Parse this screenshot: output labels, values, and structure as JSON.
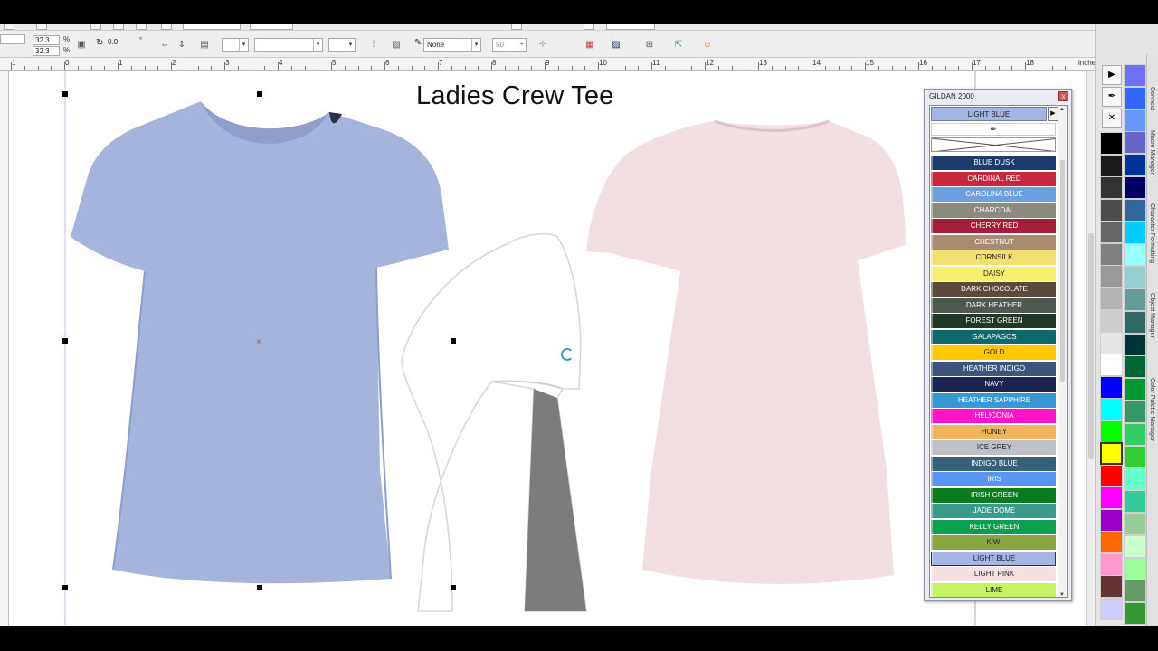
{
  "toolbar": {
    "size_w": "32.3",
    "size_h": "32.3",
    "pct_w": "%",
    "pct_h": "%",
    "rotation": "0.0",
    "degree": "°",
    "outline": "None",
    "opacity": "50"
  },
  "ruler": {
    "unit": "inches",
    "labels": [
      "1",
      "0",
      "1",
      "2",
      "3",
      "4",
      "5",
      "6",
      "7",
      "8",
      "9",
      "10",
      "11",
      "12",
      "13",
      "14",
      "15",
      "16",
      "17",
      "18"
    ]
  },
  "canvas": {
    "title": "Ladies Crew Tee"
  },
  "shirts": {
    "front_color": "#a4b4dc",
    "side_color": "#ffffff",
    "back_color": "#f1dfe2"
  },
  "docker": {
    "title": "GILDAN 2000",
    "close": "x",
    "current": "LIGHT BLUE",
    "current_arrow": "▶",
    "eyedropper": "✒",
    "scroll_up": "▲",
    "scroll_down": "▼",
    "colors": [
      {
        "name": "BLUE DUSK",
        "hex": "#1b3d6e"
      },
      {
        "name": "CARDINAL RED",
        "hex": "#c8283c"
      },
      {
        "name": "CAROLINA BLUE",
        "hex": "#6c9fdc"
      },
      {
        "name": "CHARCOAL",
        "hex": "#8a8a80"
      },
      {
        "name": "CHERRY RED",
        "hex": "#a51e3a"
      },
      {
        "name": "CHESTNUT",
        "hex": "#a88c72"
      },
      {
        "name": "CORNSILK",
        "hex": "#f4e070"
      },
      {
        "name": "DAISY",
        "hex": "#f6ef6b"
      },
      {
        "name": "DARK CHOCOLATE",
        "hex": "#5b4a3c"
      },
      {
        "name": "DARK HEATHER",
        "hex": "#505852"
      },
      {
        "name": "FOREST GREEN",
        "hex": "#223826"
      },
      {
        "name": "GALAPAGOS",
        "hex": "#0e6a6a"
      },
      {
        "name": "GOLD",
        "hex": "#ffc800"
      },
      {
        "name": "HEATHER INDIGO",
        "hex": "#3c557c"
      },
      {
        "name": "NAVY",
        "hex": "#1c2550"
      },
      {
        "name": "HEATHER SAPPHIRE",
        "hex": "#3898d4"
      },
      {
        "name": "HELICONIA",
        "hex": "#ff14c8"
      },
      {
        "name": "HONEY",
        "hex": "#f0b45c"
      },
      {
        "name": "ICE GREY",
        "hex": "#bcc0c8"
      },
      {
        "name": "INDIGO BLUE",
        "hex": "#35627a"
      },
      {
        "name": "IRIS",
        "hex": "#5895f0"
      },
      {
        "name": "IRISH GREEN",
        "hex": "#0a7c1e"
      },
      {
        "name": "JADE DOME",
        "hex": "#3c9a8c"
      },
      {
        "name": "KELLY GREEN",
        "hex": "#0aa050"
      },
      {
        "name": "KIWI",
        "hex": "#8aa640"
      },
      {
        "name": "LIGHT BLUE",
        "hex": "#a4b4e4"
      },
      {
        "name": "LIGHT PINK",
        "hex": "#f4e2e2"
      },
      {
        "name": "LIME",
        "hex": "#c4f464"
      }
    ]
  },
  "palette": {
    "tools": [
      "▶",
      "✒",
      "✕"
    ],
    "col1": [
      "#000000",
      "#1a1a1a",
      "#333333",
      "#4d4d4d",
      "#666666",
      "#808080",
      "#999999",
      "#b3b3b3",
      "#cccccc",
      "#e6e6e6",
      "#ffffff",
      "#0000ff",
      "#00ffff",
      "#00ff00",
      "#ffff00",
      "#ff0000",
      "#ff00ff",
      "#9900cc",
      "#ff6600",
      "#ff99cc",
      "#663333",
      "#ccccff"
    ],
    "col2": [
      "#6f6fff",
      "#3366ff",
      "#6699ff",
      "#6666cc",
      "#003399",
      "#000066",
      "#336699",
      "#00ccff",
      "#99ffff",
      "#99cccc",
      "#669999",
      "#336666",
      "#003333",
      "#006633",
      "#009933",
      "#339966",
      "#33cc66",
      "#33cc33",
      "#66ffcc",
      "#33cc99",
      "#99cc99",
      "#ccffcc",
      "#99ff99",
      "#669966",
      "#339933"
    ],
    "scroll_up": "▲",
    "scroll_down": "▼"
  },
  "side_tabs": [
    "Connect",
    "Macro Manager",
    "Character Formatting",
    "Object Manager",
    "Color Palette Manager"
  ]
}
